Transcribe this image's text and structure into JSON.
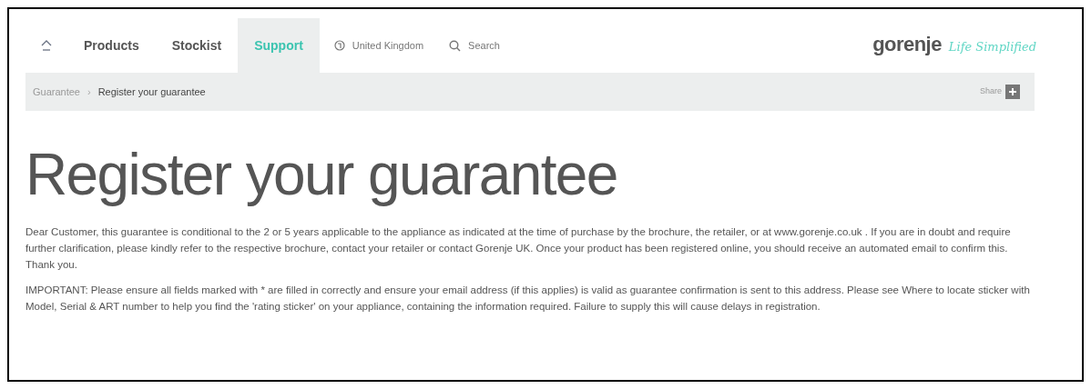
{
  "nav": {
    "items": [
      {
        "label": "Products",
        "selected": false
      },
      {
        "label": "Stockist",
        "selected": false
      },
      {
        "label": "Support",
        "selected": true
      }
    ],
    "region": "United Kingdom",
    "search": "Search"
  },
  "logo": {
    "brand": "gorenje",
    "tagline": "Life Simplified"
  },
  "breadcrumb": {
    "items": [
      "Guarantee",
      "Register your guarantee"
    ],
    "separator": "›"
  },
  "share": "Share",
  "heading": "Register your guarantee",
  "paragraphs": [
    "Dear Customer, this guarantee is conditional to the 2 or 5 years applicable to the appliance as indicated at the time of purchase by the brochure, the retailer, or at www.gorenje.co.uk . If you are in doubt and require further clarification, please kindly refer to the respective brochure, contact your retailer or contact Gorenje UK.  Once your product has been registered online, you should receive an automated email to confirm this. Thank you.",
    "IMPORTANT: Please ensure all fields marked with * are filled in correctly and ensure your email address (if this applies) is valid as guarantee confirmation is sent to this address. Please see Where to locate sticker with Model, Serial & ART number to help you find the 'rating sticker' on your appliance, containing the information required. Failure to supply this will cause delays in registration."
  ]
}
